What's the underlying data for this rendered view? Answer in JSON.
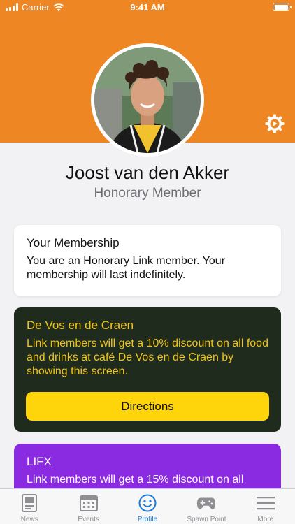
{
  "status_bar": {
    "carrier": "Carrier",
    "time": "9:41 AM"
  },
  "profile": {
    "name": "Joost van den Akker",
    "role": "Honorary Member"
  },
  "membership": {
    "title": "Your Membership",
    "text": "You are an Honorary Link member. Your membership will last indefinitely."
  },
  "offers": [
    {
      "title": "De Vos en de Craen",
      "text": "Link members will get a 10% discount on all food and drinks at café De Vos en de Craen by showing this screen.",
      "button": "Directions"
    },
    {
      "title": "LIFX",
      "text": "Link members will get a 15% discount on all"
    }
  ],
  "tabs": [
    {
      "label": "News",
      "icon": "news-icon"
    },
    {
      "label": "Events",
      "icon": "calendar-icon"
    },
    {
      "label": "Profile",
      "icon": "smiley-icon",
      "active": true
    },
    {
      "label": "Spawn Point",
      "icon": "gamepad-icon"
    },
    {
      "label": "More",
      "icon": "menu-icon"
    }
  ],
  "colors": {
    "header": "#ee8723",
    "active_tab": "#1a7bd6",
    "vos_card": "#1e2b1d",
    "vos_text": "#f0c419",
    "directions_button": "#fed40a",
    "lifx_card": "#8a2be2"
  }
}
